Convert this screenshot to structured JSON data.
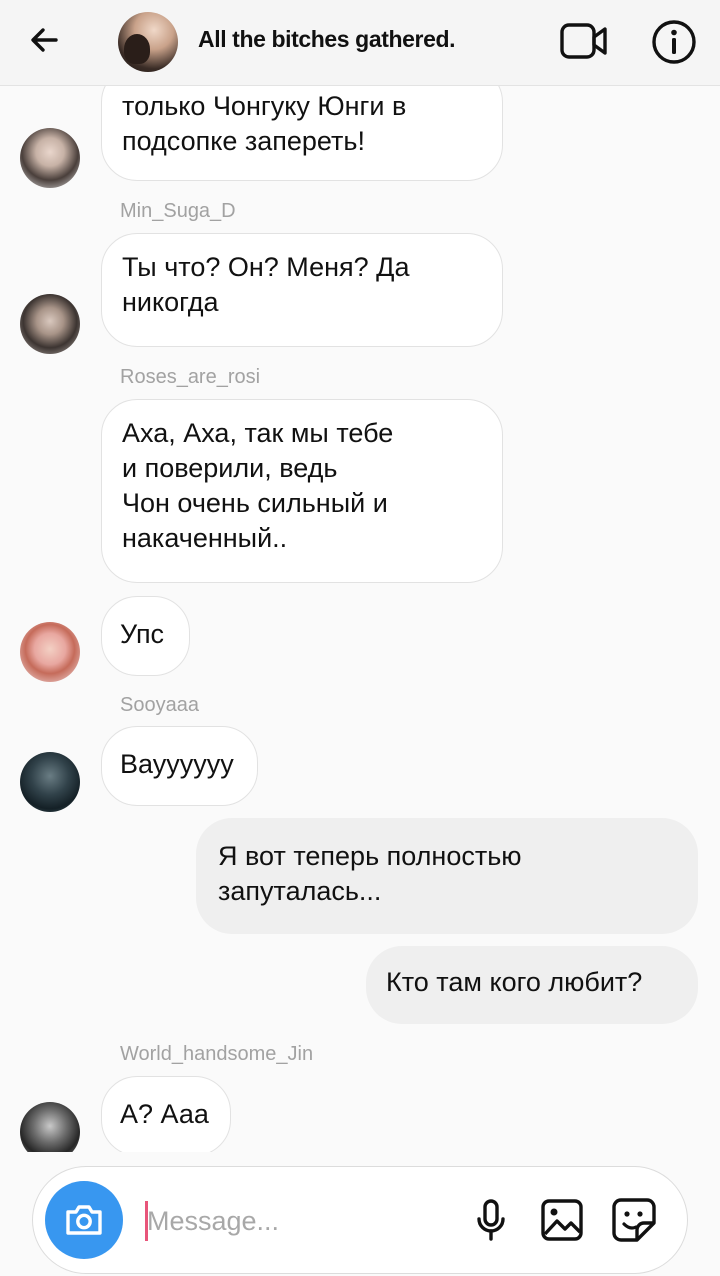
{
  "header": {
    "title": "All the bitches gathered.",
    "icons": {
      "back": "arrow-left-icon",
      "video": "video-camera-icon",
      "info": "info-icon"
    }
  },
  "messages": [
    {
      "type": "incoming",
      "text": "только Чонгуку Юнги в\nподсопке запереть!"
    },
    {
      "type": "sender",
      "name": "Min_Suga_D"
    },
    {
      "type": "incoming",
      "text": "Ты что? Он? Меня? Да\nникогда"
    },
    {
      "type": "sender",
      "name": "Roses_are_rosi"
    },
    {
      "type": "incoming",
      "text": "Аха, Аха, так мы тебе\nи поверили, ведь\nЧон очень сильный и\nнакаченный.."
    },
    {
      "type": "incoming",
      "text": "Упс"
    },
    {
      "type": "sender",
      "name": "Sooyaaa"
    },
    {
      "type": "incoming",
      "text": "Вауууууу"
    },
    {
      "type": "outgoing",
      "text": "Я вот теперь полностью\nзапуталась..."
    },
    {
      "type": "outgoing",
      "text": "Кто там кого любит?"
    },
    {
      "type": "sender",
      "name": "World_handsome_Jin"
    },
    {
      "type": "incoming",
      "text": "А? Ааа"
    }
  ],
  "composer": {
    "placeholder": "Message...",
    "accent_color": "#3897f0",
    "icons": {
      "camera": "camera-icon",
      "mic": "microphone-icon",
      "gallery": "image-icon",
      "sticker": "sticker-icon"
    }
  }
}
